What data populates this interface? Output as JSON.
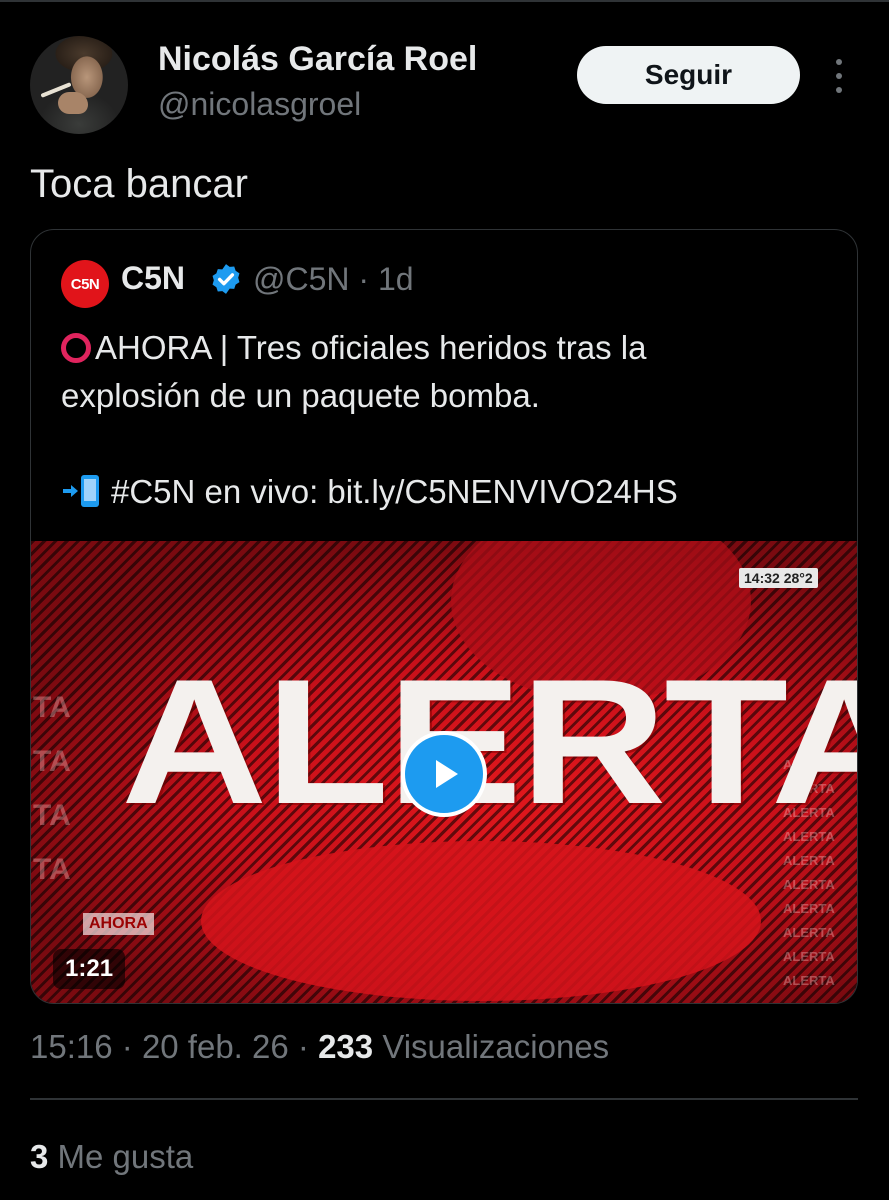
{
  "author": {
    "name": "Nicolás García Roel",
    "handle": "@nicolasgroel",
    "avatar_icon": "user-avatar-photo"
  },
  "follow_button": {
    "label": "Seguir"
  },
  "more_menu": {
    "icon": "more-vertical-icon"
  },
  "tweet": {
    "text": "Toca bancar"
  },
  "quoted": {
    "logo_text": "C5N",
    "name": "C5N",
    "verified": true,
    "verified_color": "#1d9bf0",
    "handle": "@C5N",
    "separator": "·",
    "time": "1d",
    "line1": "AHORA | Tres oficiales heridos tras la",
    "line2": "explosión de un paquete bomba.",
    "line3": "#C5N en vivo: bit.ly/C5NENVIVO24HS",
    "line1_icon": "red-circle-icon",
    "line3_icon": "phone-arrow-icon",
    "video": {
      "headline": "ALERTA",
      "side_text": "TA",
      "side_text_right": "ALERTA",
      "ticker": "AHORA",
      "clock": "14:32  28°2",
      "duration": "1:21",
      "play_icon": "play-icon"
    }
  },
  "meta": {
    "time": "15:16",
    "date": "20 feb. 26",
    "separator": "·",
    "views": "233",
    "views_label": "Visualizaciones"
  },
  "likes": {
    "count": "3",
    "label": "Me gusta"
  },
  "colors": {
    "background": "#000000",
    "text": "#e7e9ea",
    "secondary": "#71767b",
    "accent": "#1d9bf0",
    "c5n_red": "#e1141a"
  }
}
